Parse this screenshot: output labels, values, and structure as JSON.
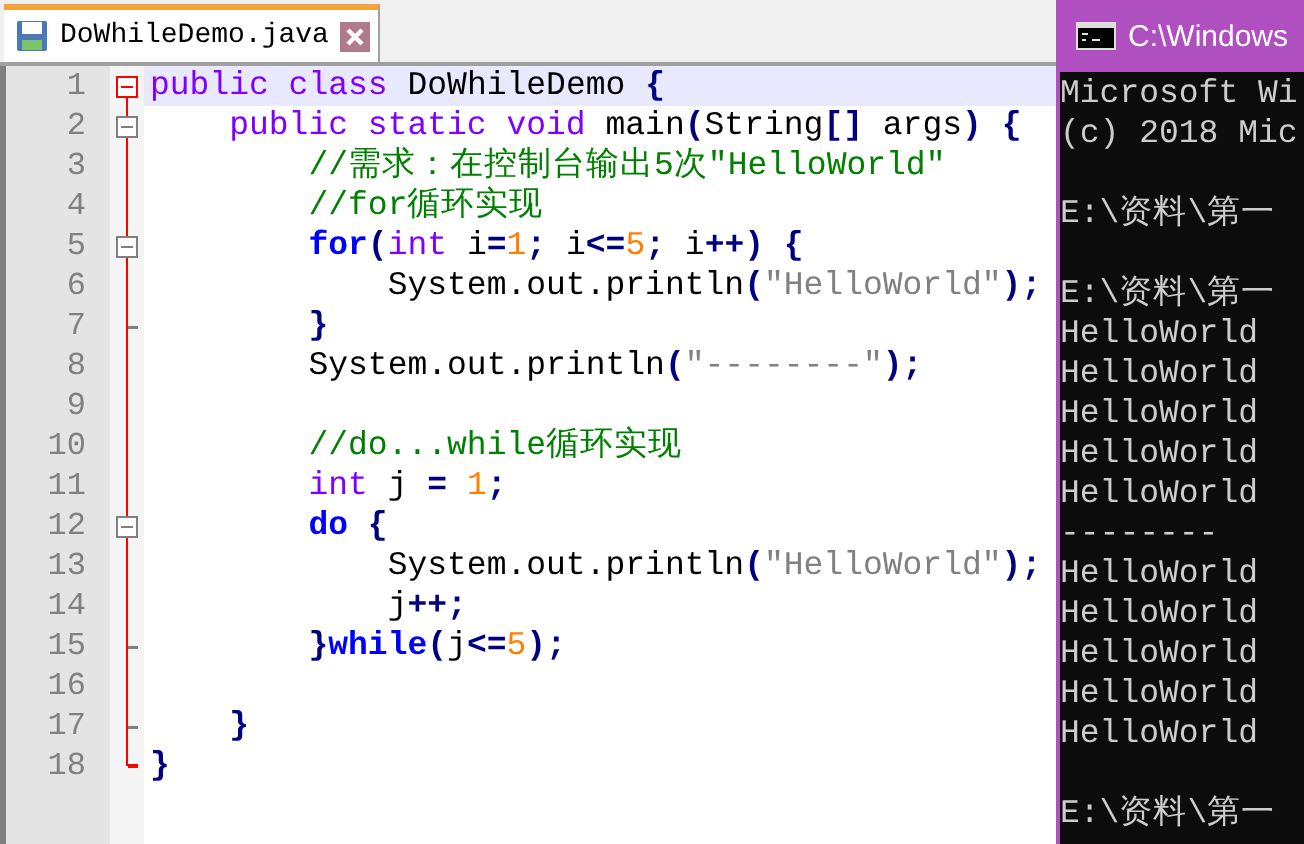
{
  "editor": {
    "tab": {
      "label": "DoWhileDemo.java",
      "selected": true
    },
    "lines": [
      {
        "number": "1",
        "current": true,
        "fold_start": true,
        "fold_end": false,
        "tokens": [
          {
            "kind": "kw",
            "text": "public class "
          },
          {
            "kind": "txt",
            "text": "DoWhileDemo "
          },
          {
            "kind": "op",
            "text": "{"
          }
        ]
      },
      {
        "number": "2",
        "current": false,
        "fold_start": true,
        "fold_end": false,
        "tokens": [
          {
            "kind": "kw",
            "text": "    public static void "
          },
          {
            "kind": "txt",
            "text": "main"
          },
          {
            "kind": "op",
            "text": "("
          },
          {
            "kind": "txt",
            "text": "String"
          },
          {
            "kind": "op",
            "text": "[]"
          },
          {
            "kind": "txt",
            "text": " args"
          },
          {
            "kind": "op",
            "text": ") {"
          }
        ]
      },
      {
        "number": "3",
        "current": false,
        "fold_start": false,
        "fold_end": false,
        "tokens": [
          {
            "kind": "cmt",
            "text": "        //需求：在控制台输出5次\"HelloWorld\""
          }
        ]
      },
      {
        "number": "4",
        "current": false,
        "fold_start": false,
        "fold_end": false,
        "tokens": [
          {
            "kind": "cmt",
            "text": "        //for循环实现"
          }
        ]
      },
      {
        "number": "5",
        "current": false,
        "fold_start": true,
        "fold_end": false,
        "tokens": [
          {
            "kind": "ctl",
            "text": "        for"
          },
          {
            "kind": "op",
            "text": "("
          },
          {
            "kind": "kw",
            "text": "int"
          },
          {
            "kind": "txt",
            "text": " i"
          },
          {
            "kind": "op",
            "text": "="
          },
          {
            "kind": "num",
            "text": "1"
          },
          {
            "kind": "op",
            "text": ";"
          },
          {
            "kind": "txt",
            "text": " i"
          },
          {
            "kind": "op",
            "text": "<="
          },
          {
            "kind": "num",
            "text": "5"
          },
          {
            "kind": "op",
            "text": ";"
          },
          {
            "kind": "txt",
            "text": " i"
          },
          {
            "kind": "op",
            "text": "++) {"
          }
        ]
      },
      {
        "number": "6",
        "current": false,
        "fold_start": false,
        "fold_end": false,
        "tokens": [
          {
            "kind": "txt",
            "text": "            System.out.println"
          },
          {
            "kind": "op",
            "text": "("
          },
          {
            "kind": "str",
            "text": "\"HelloWorld\""
          },
          {
            "kind": "op",
            "text": ");"
          }
        ]
      },
      {
        "number": "7",
        "current": false,
        "fold_start": false,
        "fold_end": true,
        "tokens": [
          {
            "kind": "op",
            "text": "        }"
          }
        ]
      },
      {
        "number": "8",
        "current": false,
        "fold_start": false,
        "fold_end": false,
        "tokens": [
          {
            "kind": "txt",
            "text": "        System.out.println"
          },
          {
            "kind": "op",
            "text": "("
          },
          {
            "kind": "str",
            "text": "\"--------\""
          },
          {
            "kind": "op",
            "text": ");"
          }
        ]
      },
      {
        "number": "9",
        "current": false,
        "fold_start": false,
        "fold_end": false
      },
      {
        "number": "10",
        "current": false,
        "fold_start": false,
        "fold_end": false,
        "tokens": [
          {
            "kind": "cmt",
            "text": "        //do...while循环实现"
          }
        ]
      },
      {
        "number": "11",
        "current": false,
        "fold_start": false,
        "fold_end": false,
        "tokens": [
          {
            "kind": "kw",
            "text": "        int"
          },
          {
            "kind": "txt",
            "text": " j "
          },
          {
            "kind": "op",
            "text": "= "
          },
          {
            "kind": "num",
            "text": "1"
          },
          {
            "kind": "op",
            "text": ";"
          }
        ]
      },
      {
        "number": "12",
        "current": false,
        "fold_start": true,
        "fold_end": false,
        "tokens": [
          {
            "kind": "ctl",
            "text": "        do"
          },
          {
            "kind": "op",
            "text": " {"
          }
        ]
      },
      {
        "number": "13",
        "current": false,
        "fold_start": false,
        "fold_end": false,
        "tokens": [
          {
            "kind": "txt",
            "text": "            System.out.println"
          },
          {
            "kind": "op",
            "text": "("
          },
          {
            "kind": "str",
            "text": "\"HelloWorld\""
          },
          {
            "kind": "op",
            "text": ");"
          }
        ]
      },
      {
        "number": "14",
        "current": false,
        "fold_start": false,
        "fold_end": false,
        "tokens": [
          {
            "kind": "txt",
            "text": "            j"
          },
          {
            "kind": "op",
            "text": "++;"
          }
        ]
      },
      {
        "number": "15",
        "current": false,
        "fold_start": false,
        "fold_end": true,
        "tokens": [
          {
            "kind": "op",
            "text": "        }"
          },
          {
            "kind": "ctl",
            "text": "while"
          },
          {
            "kind": "op",
            "text": "("
          },
          {
            "kind": "txt",
            "text": "j"
          },
          {
            "kind": "op",
            "text": "<="
          },
          {
            "kind": "num",
            "text": "5"
          },
          {
            "kind": "op",
            "text": ");"
          }
        ]
      },
      {
        "number": "16",
        "current": false,
        "fold_start": false,
        "fold_end": false
      },
      {
        "number": "17",
        "current": false,
        "fold_start": false,
        "fold_end": true,
        "tokens": [
          {
            "kind": "op",
            "text": "    }"
          }
        ]
      },
      {
        "number": "18",
        "current": false,
        "fold_start": false,
        "fold_end": true,
        "tokens": [
          {
            "kind": "op",
            "text": "}"
          }
        ]
      }
    ]
  },
  "console": {
    "title": "C:\\Windows",
    "lines": [
      {
        "kind": "text",
        "text": "Microsoft Wi"
      },
      {
        "kind": "text",
        "text": "(c) 2018 Mic"
      },
      {
        "kind": "blank"
      },
      {
        "kind": "text",
        "text": "E:\\资料\\第一"
      },
      {
        "kind": "blank"
      },
      {
        "kind": "text",
        "text": "E:\\资料\\第一"
      },
      {
        "kind": "text",
        "text": "HelloWorld"
      },
      {
        "kind": "text",
        "text": "HelloWorld"
      },
      {
        "kind": "text",
        "text": "HelloWorld"
      },
      {
        "kind": "text",
        "text": "HelloWorld"
      },
      {
        "kind": "text",
        "text": "HelloWorld"
      },
      {
        "kind": "text",
        "text": "--------"
      },
      {
        "kind": "text",
        "text": "HelloWorld"
      },
      {
        "kind": "text",
        "text": "HelloWorld"
      },
      {
        "kind": "text",
        "text": "HelloWorld"
      },
      {
        "kind": "text",
        "text": "HelloWorld"
      },
      {
        "kind": "text",
        "text": "HelloWorld"
      },
      {
        "kind": "blank"
      },
      {
        "kind": "text",
        "text": "E:\\资料\\第一"
      }
    ]
  }
}
